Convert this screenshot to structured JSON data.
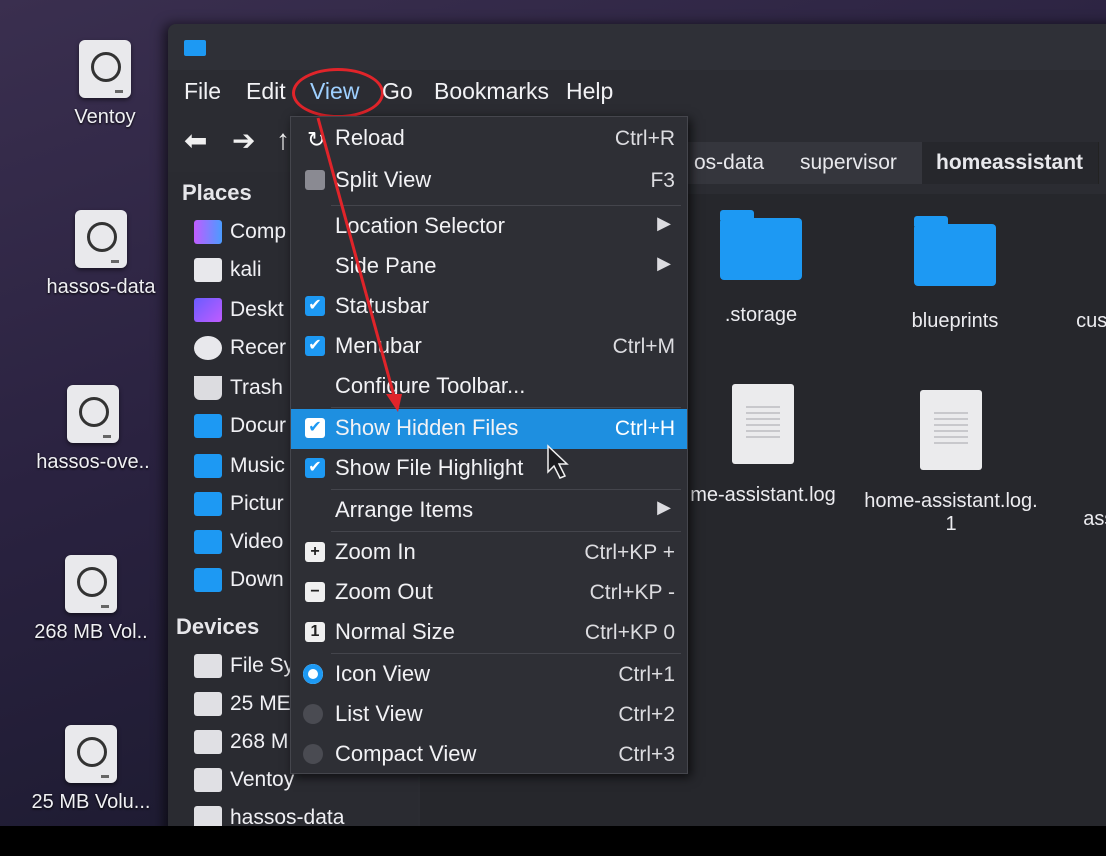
{
  "desktop": {
    "icons": [
      {
        "label": "Ventoy"
      },
      {
        "label": "hassos-data"
      },
      {
        "label": "hassos-ove.."
      },
      {
        "label": "268 MB Vol.."
      },
      {
        "label": "25 MB Volu..."
      }
    ]
  },
  "menubar": {
    "items": [
      "File",
      "Edit",
      "View",
      "Go",
      "Bookmarks",
      "Help"
    ]
  },
  "tabs": [
    "os-data",
    "supervisor",
    "homeassistant"
  ],
  "sidebar": {
    "places_heading": "Places",
    "places": [
      "Comp",
      "kali",
      "Deskt",
      "Recer",
      "Trash",
      "Docur",
      "Music",
      "Pictur",
      "Video",
      "Down"
    ],
    "devices_heading": "Devices",
    "devices": [
      "File Sy",
      "25 ME",
      "268 M",
      "Ventoy",
      "hassos-data"
    ]
  },
  "files": [
    {
      "name": ".storage",
      "kind": "folder"
    },
    {
      "name": "blueprints",
      "kind": "folder"
    },
    {
      "name": "custo",
      "kind": "folder"
    },
    {
      "name": "me-assistant.log",
      "kind": "document"
    },
    {
      "name": "home-assistant.log.",
      "name2": "1",
      "kind": "document"
    },
    {
      "name": "assis",
      "kind": "document"
    }
  ],
  "view_menu": {
    "items": [
      {
        "label": "Reload",
        "shortcut": "Ctrl+R",
        "icon": "reload-icon"
      },
      {
        "label": "Split View",
        "shortcut": "F3",
        "icon": "split-icon"
      },
      {
        "label": "Location Selector",
        "submenu": true
      },
      {
        "label": "Side Pane",
        "submenu": true
      },
      {
        "label": "Statusbar",
        "checked": true
      },
      {
        "label": "Menubar",
        "shortcut": "Ctrl+M",
        "checked": true
      },
      {
        "label": "Configure Toolbar..."
      },
      {
        "label": "Show Hidden Files",
        "shortcut": "Ctrl+H",
        "checked": true,
        "highlighted": true
      },
      {
        "label": "Show File Highlight",
        "checked": true
      },
      {
        "label": "Arrange Items",
        "submenu": true
      },
      {
        "label": "Zoom In",
        "shortcut": "Ctrl+KP +",
        "icon": "zoom-in-icon"
      },
      {
        "label": "Zoom Out",
        "shortcut": "Ctrl+KP -",
        "icon": "zoom-out-icon"
      },
      {
        "label": "Normal Size",
        "shortcut": "Ctrl+KP 0",
        "icon": "normal-size-icon"
      },
      {
        "label": "Icon View",
        "shortcut": "Ctrl+1",
        "radio": "on"
      },
      {
        "label": "List View",
        "shortcut": "Ctrl+2",
        "radio": "off"
      },
      {
        "label": "Compact View",
        "shortcut": "Ctrl+3",
        "radio": "off"
      }
    ]
  },
  "colors": {
    "accent": "#1d99f3",
    "annotation": "#e0242a"
  }
}
